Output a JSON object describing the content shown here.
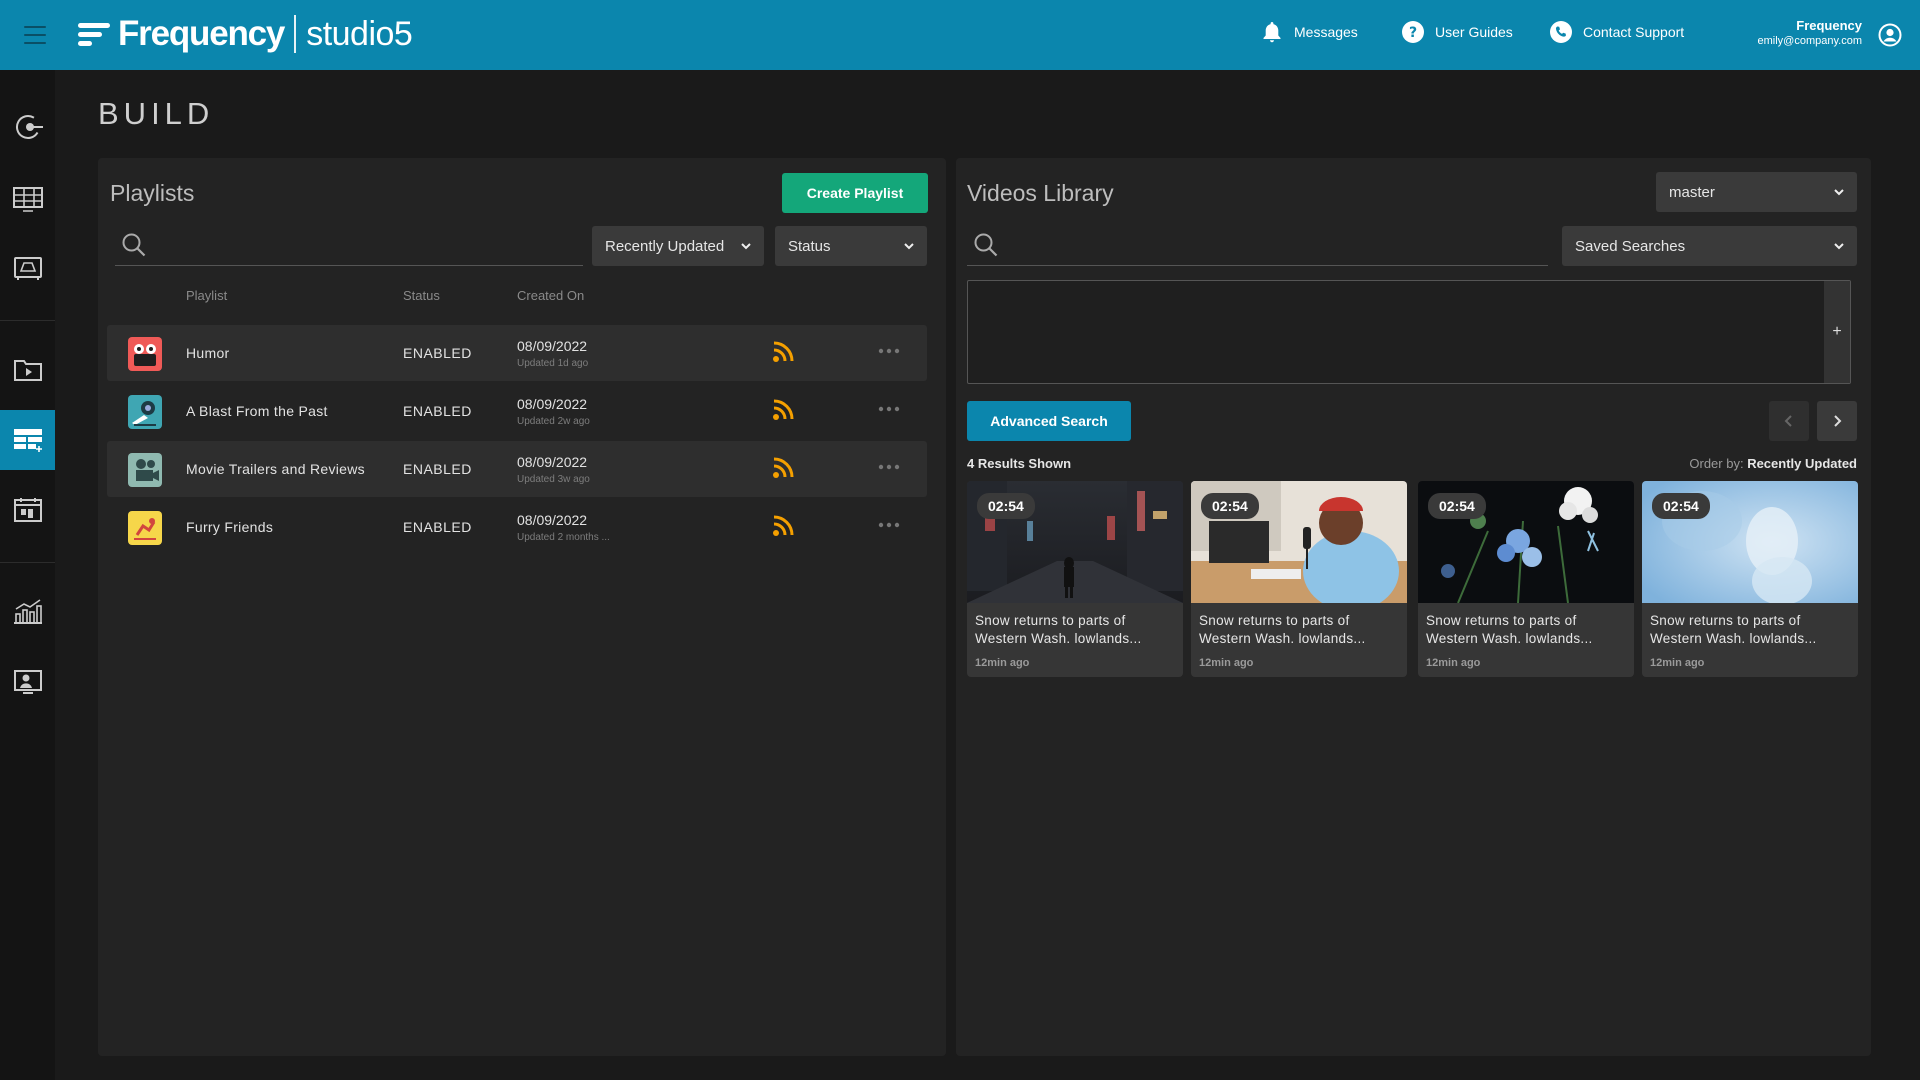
{
  "header": {
    "brand": "Frequency",
    "product": "studio5",
    "messages_label": "Messages",
    "guides_label": "User Guides",
    "support_label": "Contact Support",
    "user_name": "Frequency",
    "user_email": "emily@company.com"
  },
  "colors": {
    "header": "#0b86ad",
    "accent_green": "#14a77a",
    "accent_blue": "#0b86ad",
    "rss": "#f5a000"
  },
  "rail": {
    "items": [
      {
        "icon": "broadcast-icon"
      },
      {
        "icon": "schedule-grid-icon"
      },
      {
        "icon": "channel-icon"
      },
      {
        "icon": "media-folder-icon"
      },
      {
        "icon": "build-playlist-icon",
        "active": true
      },
      {
        "icon": "calendar-icon"
      },
      {
        "icon": "analytics-icon"
      },
      {
        "icon": "user-screen-icon"
      }
    ]
  },
  "page": {
    "title": "BUILD"
  },
  "playlists": {
    "title": "Playlists",
    "create_label": "Create Playlist",
    "search_placeholder": "",
    "sort_value": "Recently Updated",
    "status_value": "Status",
    "columns": {
      "playlist": "Playlist",
      "status": "Status",
      "created": "Created On"
    },
    "rows": [
      {
        "name": "Humor",
        "status": "ENABLED",
        "date": "08/09/2022",
        "updated": "Updated 1d ago",
        "thumb": "humor"
      },
      {
        "name": "A Blast From the Past",
        "status": "ENABLED",
        "date": "08/09/2022",
        "updated": "Updated 2w ago",
        "thumb": "blast"
      },
      {
        "name": "Movie Trailers and Reviews",
        "status": "ENABLED",
        "date": "08/09/2022",
        "updated": "Updated 3w ago",
        "thumb": "movie"
      },
      {
        "name": "Furry Friends",
        "status": "ENABLED",
        "date": "08/09/2022",
        "updated": "Updated 2 months ...",
        "thumb": "furry"
      }
    ]
  },
  "library": {
    "title": "Videos Library",
    "branch_value": "master",
    "saved_searches": "Saved Searches",
    "search_placeholder": "",
    "advanced_label": "Advanced Search",
    "results_label": "4 Results Shown",
    "order_prefix": "Order by:",
    "order_value": "Recently Updated",
    "cards": [
      {
        "duration": "02:54",
        "title": "Snow returns to parts of Western Wash. lowlands...",
        "meta": "12min ago",
        "art": "city"
      },
      {
        "duration": "02:54",
        "title": "Snow returns to parts of Western Wash. lowlands...",
        "meta": "12min ago",
        "art": "podcast"
      },
      {
        "duration": "02:54",
        "title": "Snow returns to parts of Western Wash. lowlands...",
        "meta": "12min ago",
        "art": "flowers"
      },
      {
        "duration": "02:54",
        "title": "Snow returns to parts of Western Wash. lowlands...",
        "meta": "12min ago",
        "art": "blue"
      }
    ]
  }
}
